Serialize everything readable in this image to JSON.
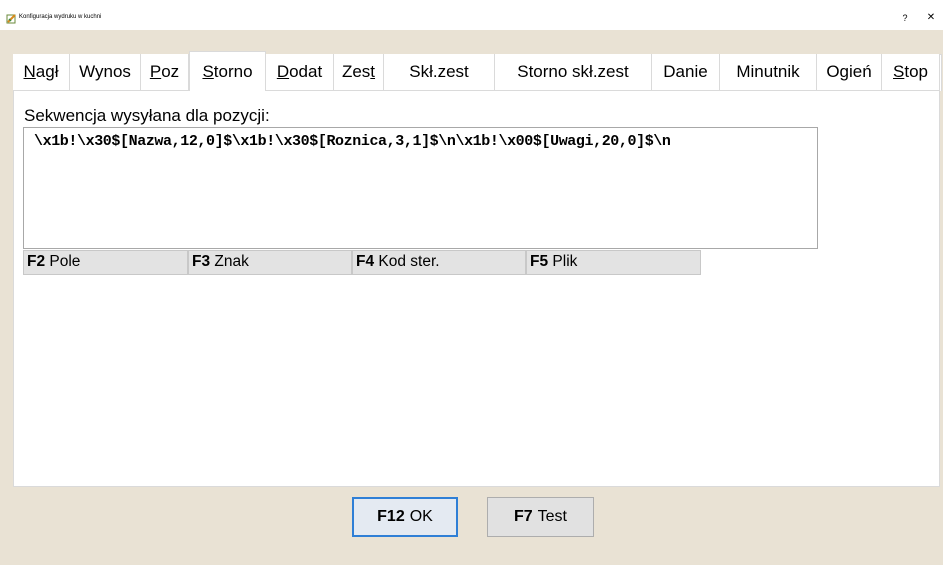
{
  "window": {
    "title": "Konfiguracja wydruku w kuchni",
    "help_glyph": "?",
    "close_glyph": "✕"
  },
  "tabs": [
    {
      "pre": "",
      "key": "N",
      "post": "agł"
    },
    {
      "pre": "Wynos",
      "key": "",
      "post": ""
    },
    {
      "pre": "",
      "key": "P",
      "post": "oz"
    },
    {
      "pre": "",
      "key": "S",
      "post": "torno"
    },
    {
      "pre": "",
      "key": "D",
      "post": "odat"
    },
    {
      "pre": "Zes",
      "key": "t",
      "post": ""
    },
    {
      "pre": "Skł.zest",
      "key": "",
      "post": ""
    },
    {
      "pre": "Storno skł.zest",
      "key": "",
      "post": ""
    },
    {
      "pre": "Danie",
      "key": "",
      "post": ""
    },
    {
      "pre": "Minutnik",
      "key": "",
      "post": ""
    },
    {
      "pre": "Ogień",
      "key": "",
      "post": ""
    },
    {
      "pre": "",
      "key": "S",
      "post": "top"
    }
  ],
  "active_tab_index": 3,
  "sequence": {
    "label": "Sekwencja wysyłana dla pozycji:",
    "value": "\\x1b!\\x30$[Nazwa,12,0]$\\x1b!\\x30$[Roznica,3,1]$\\n\\x1b!\\x00$[Uwagi,20,0]$\\n"
  },
  "function_keys": [
    {
      "key": "F2",
      "label": "Pole"
    },
    {
      "key": "F3",
      "label": "Znak"
    },
    {
      "key": "F4",
      "label": "Kod ster."
    },
    {
      "key": "F5",
      "label": "Plik"
    }
  ],
  "buttons": {
    "ok": {
      "key": "F12",
      "label": "OK"
    },
    "test": {
      "key": "F7",
      "label": "Test"
    }
  },
  "colors": {
    "dialog_background": "#e9e2d4",
    "default_button_border": "#2f7fd6"
  }
}
